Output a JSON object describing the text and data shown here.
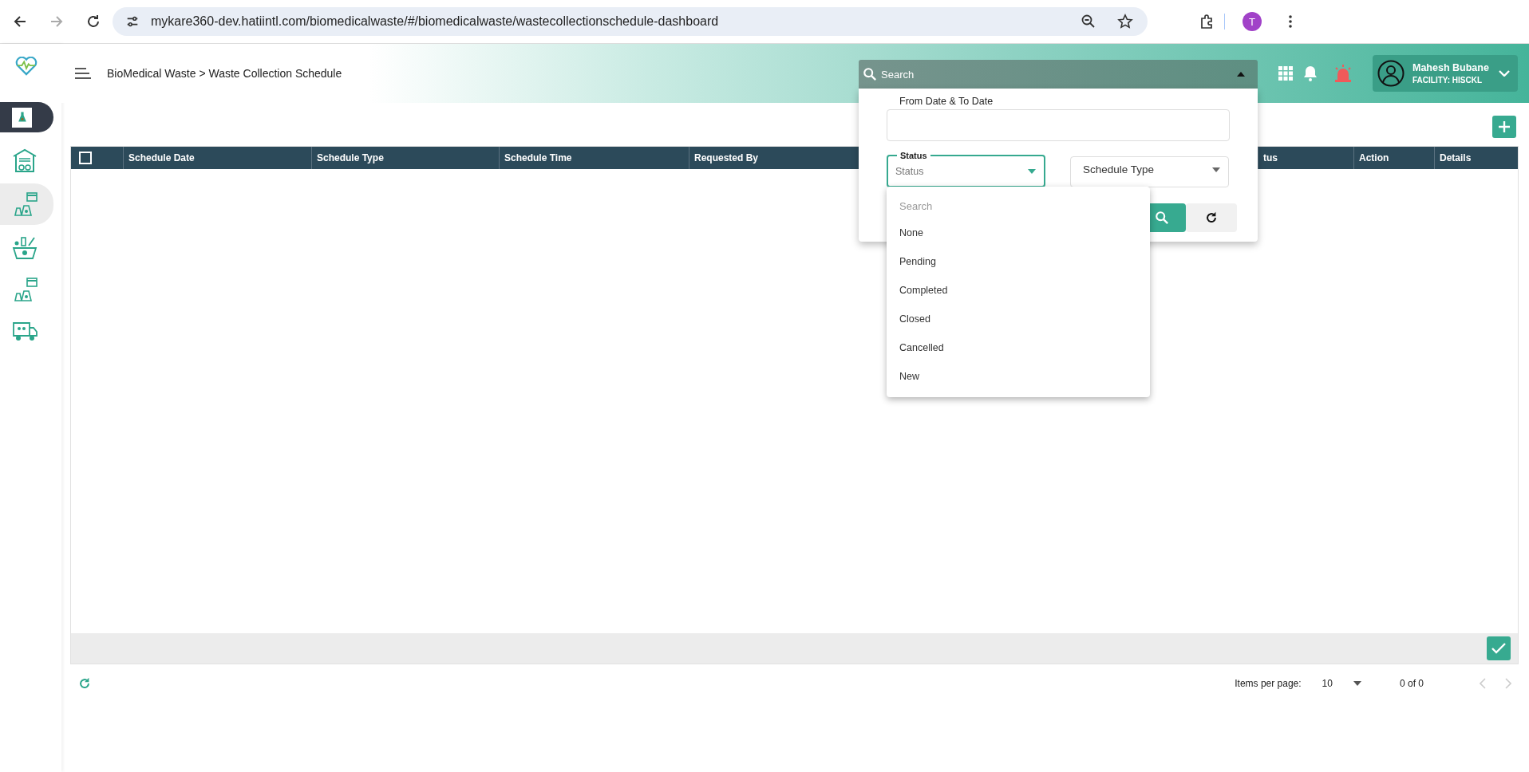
{
  "browser": {
    "url": "mykare360-dev.hatiintl.com/biomedicalwaste/#/biomedicalwaste/wastecollectionschedule-dashboard",
    "profile_initial": "T"
  },
  "sidebar": {
    "items": [
      {
        "kind": "flask",
        "selected": true,
        "hovered": false
      },
      {
        "kind": "warehouse",
        "selected": false,
        "hovered": false
      },
      {
        "kind": "bags-calendar",
        "selected": false,
        "hovered": true
      },
      {
        "kind": "basket",
        "selected": false,
        "hovered": false
      },
      {
        "kind": "bags-calendar",
        "selected": false,
        "hovered": false
      },
      {
        "kind": "truck",
        "selected": false,
        "hovered": false
      }
    ]
  },
  "header": {
    "breadcrumb": "BioMedical Waste > Waste Collection Schedule",
    "search": {
      "placeholder": "Search",
      "expanded": true
    },
    "user": {
      "name": "Mahesh Bubane",
      "facility": "FACILITY: HISCKL"
    }
  },
  "filter_panel": {
    "date_range": {
      "label": "From Date & To Date"
    },
    "status": {
      "label": "Status",
      "placeholder": "Status",
      "focused": true
    },
    "schedule_type": {
      "placeholder": "Schedule Type"
    }
  },
  "status_dropdown": {
    "open": true,
    "search_placeholder": "Search",
    "options": [
      {
        "label": "None",
        "selected": false
      },
      {
        "label": "Pending",
        "selected": false
      },
      {
        "label": "Completed",
        "selected": false
      },
      {
        "label": "Closed",
        "selected": false
      },
      {
        "label": "Cancelled",
        "selected": false
      },
      {
        "label": "New",
        "selected": false
      }
    ]
  },
  "table": {
    "select_all": {
      "checked": false
    },
    "columns": [
      {
        "kind": "checkbox"
      },
      {
        "kind": "text",
        "label": "Schedule Date"
      },
      {
        "kind": "text",
        "label": "Schedule Type"
      },
      {
        "kind": "text",
        "label": "Schedule Time"
      },
      {
        "kind": "text",
        "label": "Requested By"
      },
      {
        "kind": "text",
        "label": "tus"
      },
      {
        "kind": "text",
        "label": "Action"
      },
      {
        "kind": "text",
        "label": "Details"
      }
    ]
  },
  "paginator": {
    "items_per_page_label": "Items per page:",
    "page_size": "10",
    "range": "0 of 0",
    "previous_disabled": true,
    "next_disabled": true
  }
}
